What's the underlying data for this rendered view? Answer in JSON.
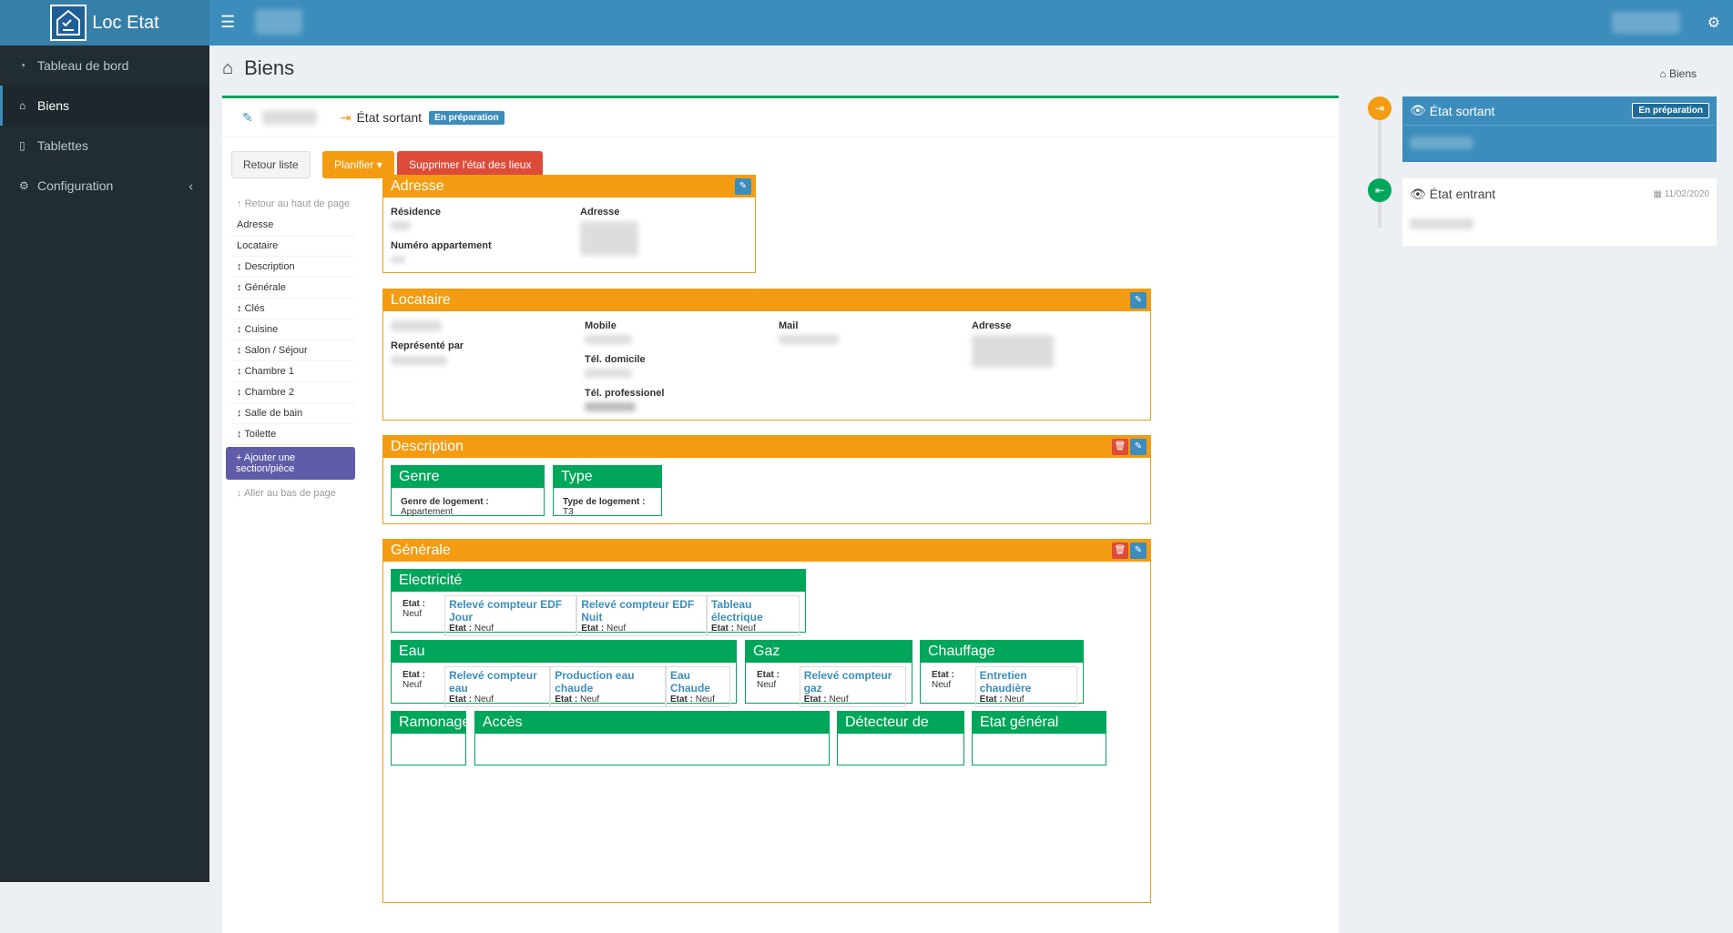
{
  "app": {
    "name": "Loc Etat"
  },
  "sidebar": {
    "items": [
      {
        "label": "Tableau de bord",
        "icon": "dashboard-icon"
      },
      {
        "label": "Biens",
        "icon": "home-icon"
      },
      {
        "label": "Tablettes",
        "icon": "tablet-icon"
      },
      {
        "label": "Configuration",
        "icon": "cogs-icon"
      }
    ]
  },
  "page": {
    "title": "Biens",
    "breadcrumb": "Biens"
  },
  "state_header": {
    "state": "État sortant",
    "badge": "En préparation"
  },
  "actions": {
    "back": "Retour liste",
    "plan": "Planifier",
    "delete": "Supprimer l'état des lieux"
  },
  "section_nav": {
    "top": "Retour au haut de page",
    "items": [
      "Adresse",
      "Locataire",
      "Description",
      "Générale",
      "Clés",
      "Cuisine",
      "Salon / Séjour",
      "Chambre 1",
      "Chambre 2",
      "Salle de bain",
      "Toilette"
    ],
    "add": "Ajouter une section/pièce",
    "bottom": "Aller au bas de page"
  },
  "adresse": {
    "title": "Adresse",
    "residence": "Résidence",
    "adresse": "Adresse",
    "numero": "Numéro appartement"
  },
  "locataire": {
    "title": "Locataire",
    "represente": "Représenté par",
    "mobile": "Mobile",
    "tel_dom": "Tél. domicile",
    "tel_pro": "Tél. professionel",
    "mail": "Mail",
    "adresse": "Adresse"
  },
  "description": {
    "title": "Description",
    "genre_title": "Genre",
    "genre_label": "Genre de logement :",
    "genre_value": "Appartement",
    "type_title": "Type",
    "type_label": "Type de logement :",
    "type_value": "T3"
  },
  "generale": {
    "title": "Générale",
    "etat_label": "Etat :",
    "etat_value": "Neuf",
    "electricite": {
      "title": "Electricité",
      "subs": [
        "Relevé compteur EDF Jour",
        "Relevé compteur EDF Nuit",
        "Tableau électrique"
      ]
    },
    "eau": {
      "title": "Eau",
      "subs": [
        "Relevé compteur eau",
        "Production eau chaude",
        "Eau Chaude"
      ]
    },
    "gaz": {
      "title": "Gaz",
      "subs": [
        "Relevé compteur gaz"
      ]
    },
    "chauffage": {
      "title": "Chauffage",
      "subs": [
        "Entretien chaudière"
      ]
    },
    "row3": [
      "Ramonage",
      "Accès",
      "Détecteur de fumée",
      "Etat général Propreté"
    ]
  },
  "timeline": {
    "sortant": {
      "title": "État sortant",
      "badge": "En préparation"
    },
    "entrant": {
      "title": "État entrant",
      "date": "11/02/2020"
    }
  }
}
